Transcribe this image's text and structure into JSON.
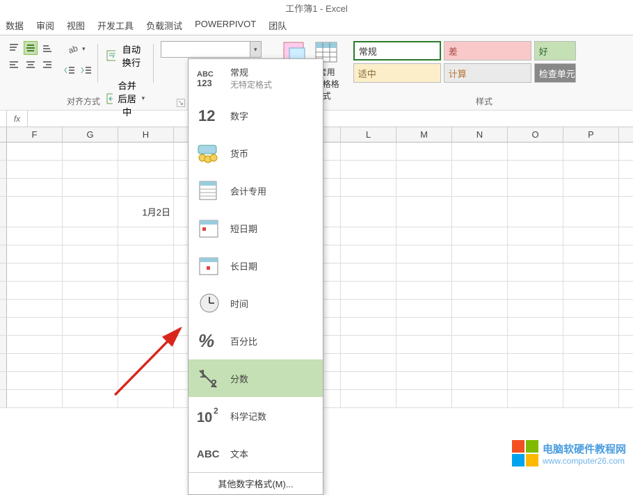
{
  "title": "工作簿1 - Excel",
  "menu": [
    "数据",
    "审阅",
    "视图",
    "开发工具",
    "负载测试",
    "POWERPIVOT",
    "团队"
  ],
  "ribbon": {
    "wrap_text": "自动换行",
    "merge_center": "合并后居中",
    "align_label": "对齐方式",
    "cond_format": "条件格式",
    "table_format": "套用\n表格格式",
    "styles_label": "样式"
  },
  "styles": {
    "normal": "常规",
    "bad": "差",
    "good": "好",
    "medium": "适中",
    "calc": "计算",
    "check": "检查单元"
  },
  "format_dropdown": {
    "items": [
      {
        "title": "常规",
        "sub": "无特定格式"
      },
      {
        "title": "数字"
      },
      {
        "title": "货币"
      },
      {
        "title": "会计专用"
      },
      {
        "title": "短日期"
      },
      {
        "title": "长日期"
      },
      {
        "title": "时间"
      },
      {
        "title": "百分比"
      },
      {
        "title": "分数"
      },
      {
        "title": "科学记数"
      },
      {
        "title": "文本"
      }
    ],
    "more": "其他数字格式(M)..."
  },
  "columns": [
    "F",
    "G",
    "H",
    "",
    "",
    "",
    "L",
    "M",
    "N",
    "O",
    "P"
  ],
  "cell_value": "1月2日",
  "fn_label": "fx",
  "watermark": {
    "line1": "电脑软硬件教程网",
    "line2": "www.computer26.com"
  }
}
